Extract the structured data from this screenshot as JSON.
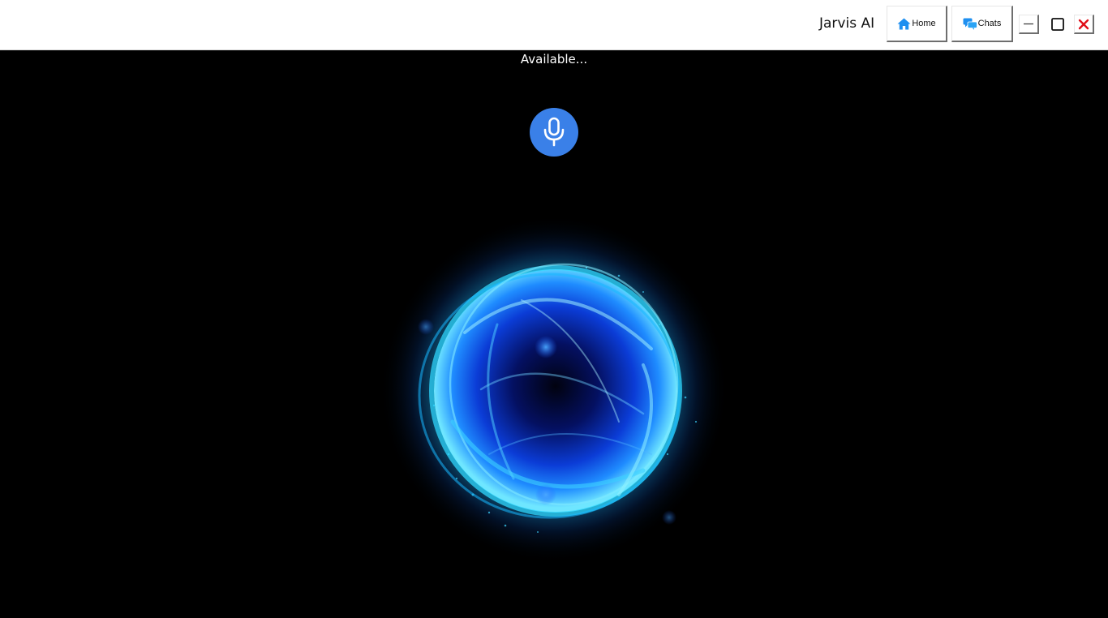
{
  "app": {
    "title": "Jarvis AI"
  },
  "nav": {
    "home_label": "Home",
    "chats_label": "Chats",
    "home_icon": "home-icon",
    "chats_icon": "chat-icon"
  },
  "window_controls": {
    "minimize_icon": "minimize-icon",
    "maximize_icon": "maximize-icon",
    "close_icon": "close-icon"
  },
  "main": {
    "status_text": "Available...",
    "mic_icon": "microphone-icon",
    "orb_visual": "energy-orb"
  },
  "colors": {
    "accent_blue": "#3a80e8",
    "orb_cyan": "#29c6ff",
    "close_red": "#e0101a",
    "background": "#000000"
  }
}
